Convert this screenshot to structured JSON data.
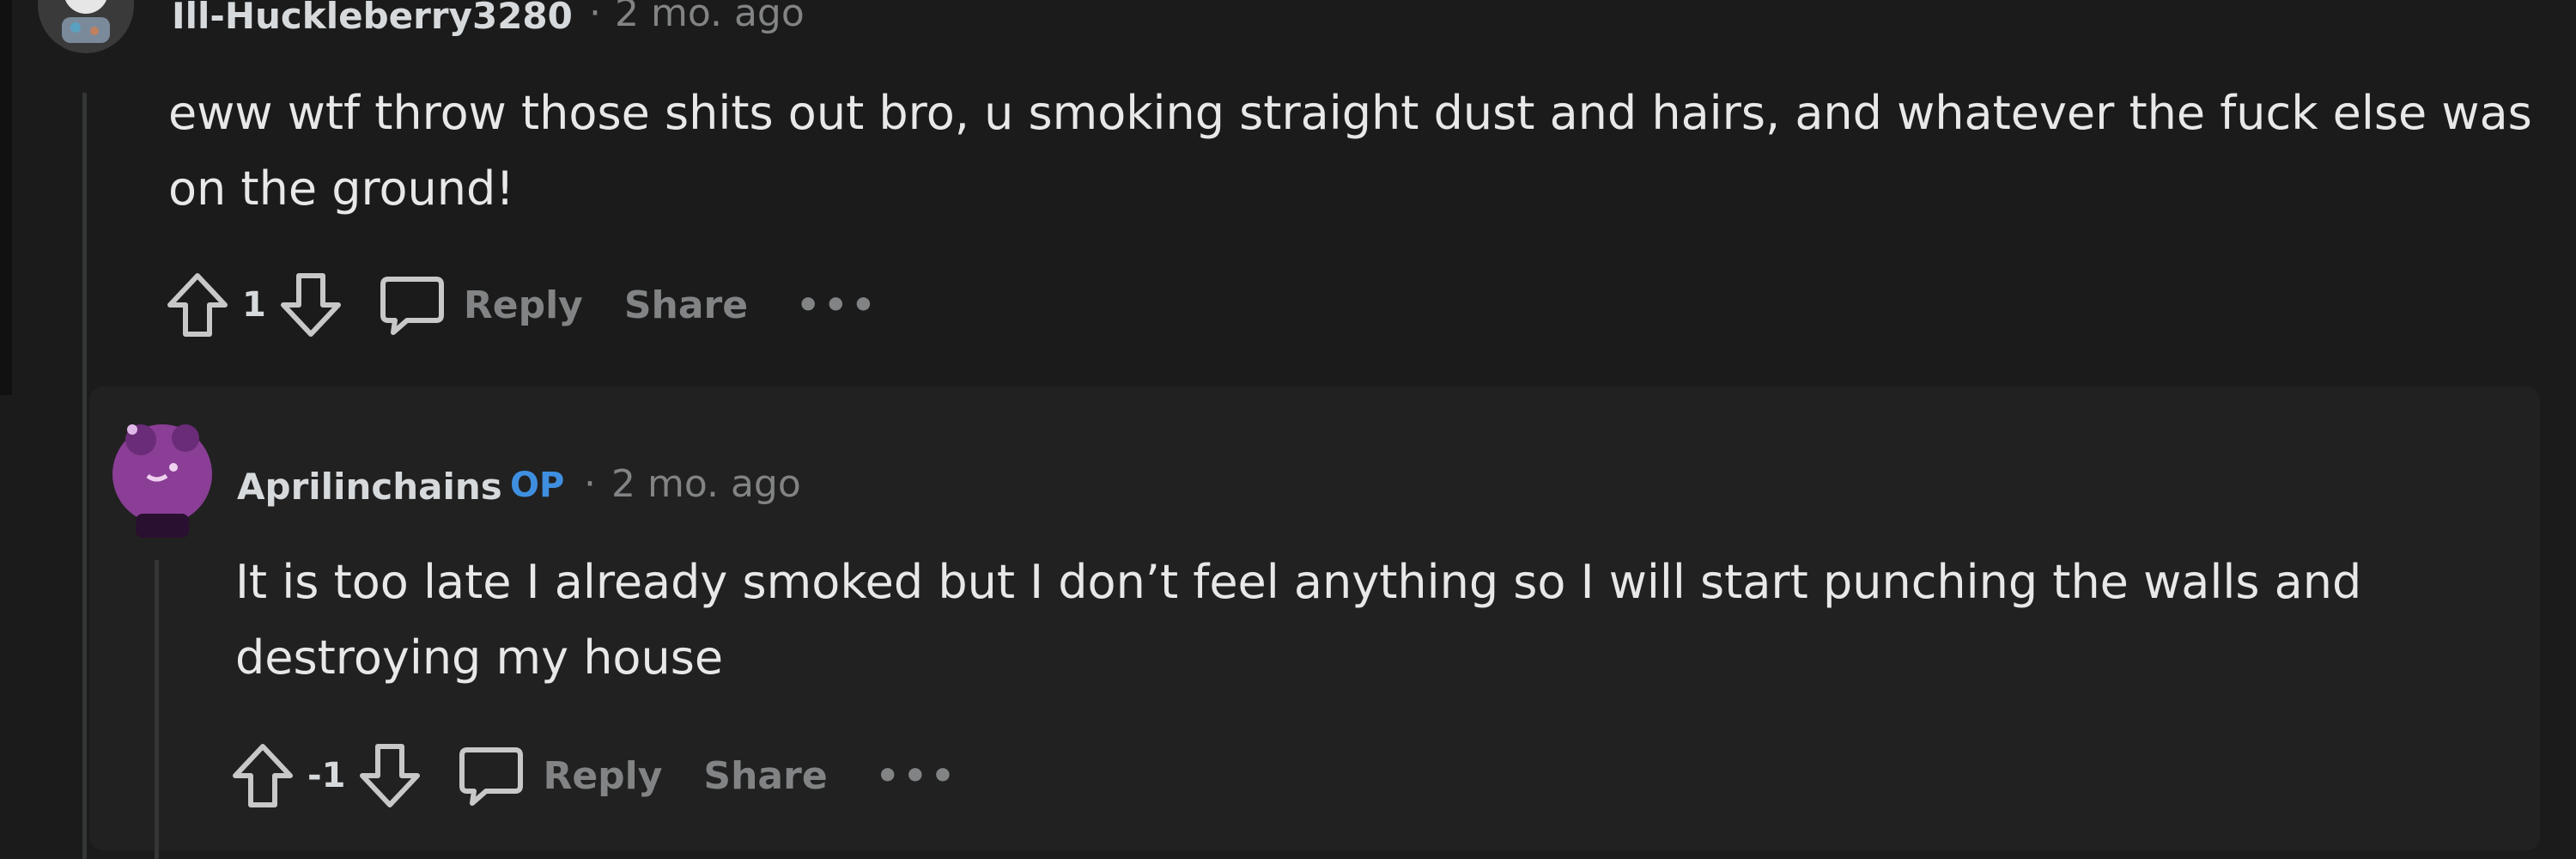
{
  "comment": {
    "username": "Ill-Huckleberry3280",
    "separator": "·",
    "age": "2 mo. ago",
    "body": "eww wtf throw those shits out bro, u smoking straight dust and hairs, and whatever the fuck else was on the ground!",
    "votes": "1",
    "reply_label": "Reply",
    "share_label": "Share",
    "more_label": "•••"
  },
  "reply": {
    "username": "Aprilinchains",
    "op_badge": "OP",
    "separator": "·",
    "age": "2 mo. ago",
    "body": "It is too late I already smoked but I don’t feel anything so I will start punching the walls and destroying my house",
    "votes": "-1",
    "reply_label": "Reply",
    "share_label": "Share",
    "more_label": "•••",
    "avatar_color": "#9b4aa8"
  },
  "colors": {
    "background": "#1b1b1b",
    "card": "#212121",
    "text": "#e8e8e8",
    "muted": "#818384",
    "op_blue": "#3f8fe0"
  }
}
